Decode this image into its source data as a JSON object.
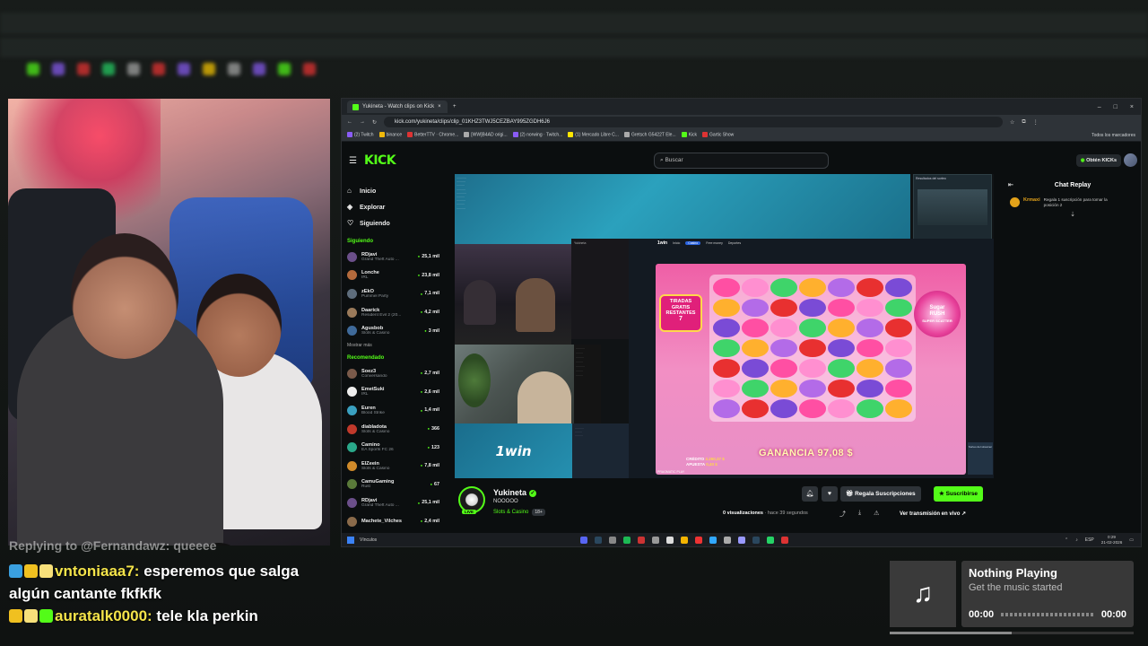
{
  "browser": {
    "tab_title": "Yukineta - Watch clips on Kick",
    "url": "kick.com/yukineta/clips/clip_01KHZ3TWJ5CEZBAY995ZGDH6J6",
    "bookmarks": [
      "(2) Twitch",
      "binance",
      "BetterTTV · Chrome...",
      "[WW]B4AD origi...",
      "(2) norwing · Twitch...",
      "(1) Mercado Libre C...",
      "Gretsch G5422T Ele...",
      "Kick",
      "Gartic Show",
      "Todos los marcadores"
    ]
  },
  "kick": {
    "logo": "KICK",
    "search_placeholder": "Buscar",
    "get_kicks": "Obtén KICKs",
    "nav": {
      "home": "Inicio",
      "explore": "Explorar",
      "following": "Siguiendo"
    },
    "following_heading": "Siguiendo",
    "show_more": "Mostrar más",
    "recommended_heading": "Recomendado",
    "following_channels": [
      {
        "name": "RDjavi",
        "category": "Grand Theft Auto ...",
        "viewers": "25,1 mil",
        "color": "#6b4f8a"
      },
      {
        "name": "Lonche",
        "category": "IRL",
        "viewers": "23,8 mil",
        "color": "#b46a3c"
      },
      {
        "name": "zEkO",
        "category": "Pummel Party",
        "viewers": "7,1 mil",
        "color": "#5e6d7c"
      },
      {
        "name": "Daarick",
        "category": "Resident Evil 2 (20...",
        "viewers": "4,2 mil",
        "color": "#9a7a5a"
      },
      {
        "name": "Agusbob",
        "category": "Slots & Casino",
        "viewers": "3 mil",
        "color": "#3f6a9a"
      }
    ],
    "recommended_channels": [
      {
        "name": "Soez3",
        "category": "Conversando",
        "viewers": "2,7 mil",
        "color": "#7a5a4a"
      },
      {
        "name": "EmetSuki",
        "category": "IRL",
        "viewers": "2,6 mil",
        "color": "#eeeeee"
      },
      {
        "name": "Euren",
        "category": "Blood Strike",
        "viewers": "1,4 mil",
        "color": "#3aa0c0"
      },
      {
        "name": "diabladota",
        "category": "Slots & Casino",
        "viewers": "366",
        "color": "#c0392b"
      },
      {
        "name": "Camino",
        "category": "EA Sports FC 26",
        "viewers": "123",
        "color": "#2aa88a"
      },
      {
        "name": "ElZeein",
        "category": "Slots & Casino",
        "viewers": "7,8 mil",
        "color": "#d08a2a"
      },
      {
        "name": "CamuGaming",
        "category": "Rust",
        "viewers": "67",
        "color": "#5a7a3a"
      },
      {
        "name": "RDjavi",
        "category": "Grand Theft Auto ...",
        "viewers": "25,1 mil",
        "color": "#6b4f8a"
      },
      {
        "name": "Machete_Vilches",
        "category": "",
        "viewers": "2,4 mil",
        "color": "#8a6a4a"
      }
    ]
  },
  "video": {
    "site_logo": "1win",
    "promo_logo": "1win",
    "nav_items": [
      "Inicio",
      "Casino",
      "Free money",
      "Deportes"
    ],
    "tiradas": [
      "TIRADAS",
      "GRATIS",
      "RESTANTES"
    ],
    "tiradas_count": "7",
    "game_logo": [
      "Sugar",
      "RUSH",
      "SUPER SCATTER"
    ],
    "ganancia": "GANANCIA 97,08 $",
    "credito_label": "CRÉDITO",
    "credito_value": "2.260,37 $",
    "apuesta_label": "APUESTA",
    "apuesta_value": "0,40 $",
    "provider": "PRAGMATIC PLAY",
    "buy_label": "Sorteo del streamer",
    "mini_title": "Resultados del sorteo"
  },
  "channel": {
    "name": "Yukineta",
    "title": "NOOOOO",
    "category": "Slots & Casino",
    "age": "18+",
    "live": "LIVE",
    "gift_button": "Regala Suscripciones",
    "subscribe_button": "Suscribirse",
    "views": "0 visualizaciones",
    "time_ago": "· hace 39 segundos",
    "vod_link": "Ver transmisión en vivo"
  },
  "chat_replay": {
    "title": "Chat Replay",
    "user": "Krmaxi",
    "message": "Regala 1 suscripción para tomar la posición 2"
  },
  "taskbar": {
    "item": "Vínculos",
    "language": "ESP",
    "time": "0:29",
    "date": "21-02-2026"
  },
  "overlay_chat": {
    "reply_line": "Replying to @Fernandawz: queeee",
    "line1_user": "vntoniaaa7:",
    "line1_text": " esperemos que salga algún cantante fkfkfk",
    "line2_user": "auratalk0000:",
    "line2_text": " tele kla perkin"
  },
  "now_playing": {
    "title": "Nothing Playing",
    "subtitle": "Get the music started",
    "time_start": "00:00",
    "time_end": "00:00",
    "progress": 0.5
  }
}
